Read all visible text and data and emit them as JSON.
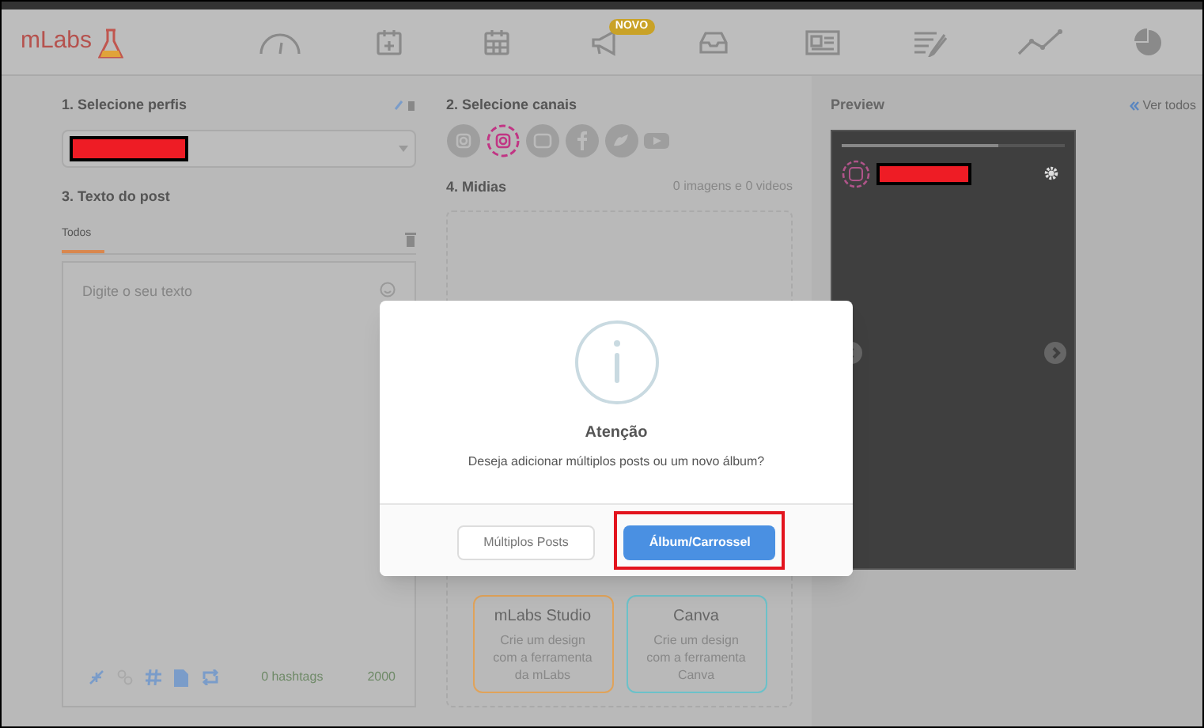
{
  "logo": {
    "text": "mLabs"
  },
  "nav": [
    {
      "kind": "gauge"
    },
    {
      "kind": "calendar-add"
    },
    {
      "kind": "calendar"
    },
    {
      "kind": "megaphone",
      "badge": "NOVO"
    },
    {
      "kind": "inbox"
    },
    {
      "kind": "news"
    },
    {
      "kind": "list-edit"
    },
    {
      "kind": "chart"
    },
    {
      "kind": "pie"
    }
  ],
  "profiles": {
    "title": "1. Selecione perfis"
  },
  "post_text": {
    "title": "3. Texto do post",
    "tabs": [
      {
        "label": "Todos",
        "selected": true
      }
    ],
    "placeholder": "Digite o seu texto",
    "hashtags": "0 hashtags",
    "count": "2000"
  },
  "channels": {
    "title": "2. Selecione canais",
    "items": [
      {
        "kind": "instagram",
        "selected": false
      },
      {
        "kind": "instagram-story",
        "selected": true
      },
      {
        "kind": "linkedin",
        "selected": false
      },
      {
        "kind": "facebook",
        "selected": false
      },
      {
        "kind": "twitter",
        "selected": false
      },
      {
        "kind": "youtube",
        "selected": false
      }
    ]
  },
  "media": {
    "title": "4. Midias",
    "summary": "0 imagens e 0 videos",
    "cards": [
      {
        "title": "mLabs Studio",
        "text": "Crie um design com a ferramenta da mLabs",
        "color": "#e0a35a"
      },
      {
        "title": "Canva",
        "text": "Crie um design com a ferramenta Canva",
        "color": "#6cc1c9"
      }
    ]
  },
  "preview": {
    "title": "Preview",
    "link": "Ver todos"
  },
  "dialog": {
    "title": "Atenção",
    "message": "Deseja adicionar múltiplos posts ou um novo álbum?",
    "buttons": [
      {
        "label": "Múltiplos Posts",
        "kind": "secondary",
        "highlighted": false
      },
      {
        "label": "Álbum/Carrossel",
        "kind": "primary",
        "highlighted": true
      }
    ]
  }
}
